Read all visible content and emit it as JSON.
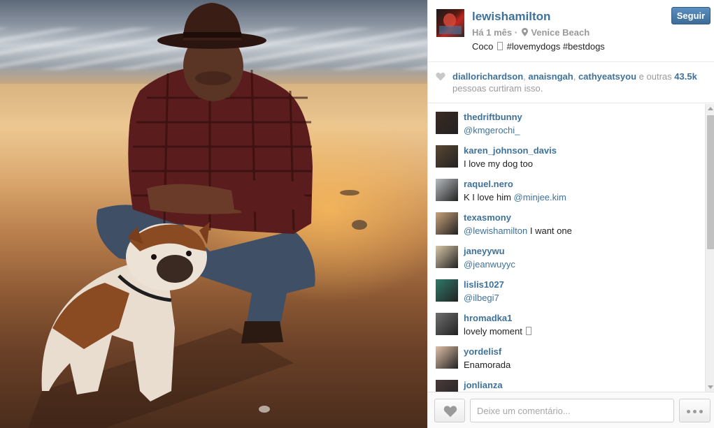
{
  "post": {
    "username": "lewishamilton",
    "time": "Há 1 mês",
    "separator": "·",
    "location": "Venice Beach",
    "caption_start": "Coco",
    "caption_tags": "#lovemydogs #bestdogs",
    "follow_label": "Seguir"
  },
  "likes": {
    "users": [
      "diallorichardson",
      "anaisngah",
      "cathyeatsyou"
    ],
    "comma": ",",
    "and_others": "e outras",
    "count": "43.5k",
    "suffix": "pessoas curtiram isso."
  },
  "comments": [
    {
      "user": "thedriftbunny",
      "mention": "@kmgerochi_",
      "text": "",
      "avatar_color": "#3b2a22"
    },
    {
      "user": "karen_johnson_davis",
      "mention": "",
      "text": "I love my dog too",
      "avatar_color": "#5a4632"
    },
    {
      "user": "raquel.nero",
      "mention": "@minjee.kim",
      "text": "K I love him ",
      "avatar_color": "#b8bcc0"
    },
    {
      "user": "texasmony",
      "mention": "@lewishamilton",
      "text": " I want one",
      "avatar_color": "#c9a27a"
    },
    {
      "user": "janeyywu",
      "mention": "@jeanwuyyc",
      "text": "",
      "avatar_color": "#d8c7a8"
    },
    {
      "user": "lislis1027",
      "mention": "@ilbegi7",
      "text": "",
      "avatar_color": "#2f7a6a"
    },
    {
      "user": "hromadka1",
      "mention": "",
      "text": "lovely moment",
      "avatar_color": "#6f6f6f"
    },
    {
      "user": "yordelisf",
      "mention": "",
      "text": "Enamorada",
      "avatar_color": "#e0c0a8"
    },
    {
      "user": "jonlianza",
      "mention": "",
      "text": "",
      "avatar_color": "#4a3a3a"
    }
  ],
  "footer": {
    "comment_placeholder": "Deixe um comentário..."
  },
  "icons": {
    "location": "map-pin-icon",
    "likes": "heart-icon",
    "like_button": "heart-icon",
    "more": "ellipsis-icon"
  },
  "colors": {
    "link": "#3f729b",
    "follow_button": "#4a7aa8",
    "muted": "#9a9a9a"
  }
}
